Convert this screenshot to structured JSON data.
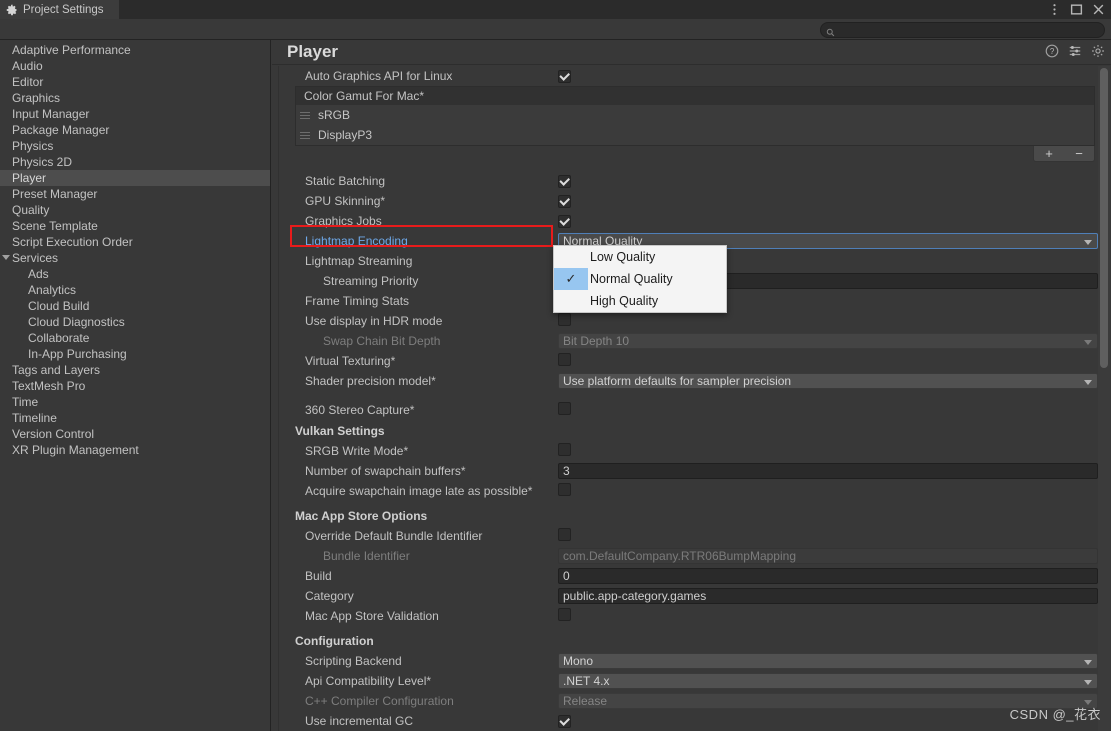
{
  "window": {
    "tab_title": "Project Settings",
    "tab_icon": "gear-icon",
    "controls": [
      "kebab-menu-icon",
      "maximize-icon",
      "close-icon"
    ]
  },
  "search": {
    "value": "",
    "placeholder": "",
    "icon": "search-icon"
  },
  "sidebar": {
    "items": [
      {
        "label": "Adaptive Performance",
        "indent": 0,
        "selected": false,
        "expandable": false
      },
      {
        "label": "Audio",
        "indent": 0,
        "selected": false,
        "expandable": false
      },
      {
        "label": "Editor",
        "indent": 0,
        "selected": false,
        "expandable": false
      },
      {
        "label": "Graphics",
        "indent": 0,
        "selected": false,
        "expandable": false
      },
      {
        "label": "Input Manager",
        "indent": 0,
        "selected": false,
        "expandable": false
      },
      {
        "label": "Package Manager",
        "indent": 0,
        "selected": false,
        "expandable": false
      },
      {
        "label": "Physics",
        "indent": 0,
        "selected": false,
        "expandable": false
      },
      {
        "label": "Physics 2D",
        "indent": 0,
        "selected": false,
        "expandable": false
      },
      {
        "label": "Player",
        "indent": 0,
        "selected": true,
        "expandable": false
      },
      {
        "label": "Preset Manager",
        "indent": 0,
        "selected": false,
        "expandable": false
      },
      {
        "label": "Quality",
        "indent": 0,
        "selected": false,
        "expandable": false
      },
      {
        "label": "Scene Template",
        "indent": 0,
        "selected": false,
        "expandable": false
      },
      {
        "label": "Script Execution Order",
        "indent": 0,
        "selected": false,
        "expandable": false
      },
      {
        "label": "Services",
        "indent": 0,
        "selected": false,
        "expandable": true
      },
      {
        "label": "Ads",
        "indent": 1,
        "selected": false,
        "expandable": false
      },
      {
        "label": "Analytics",
        "indent": 1,
        "selected": false,
        "expandable": false
      },
      {
        "label": "Cloud Build",
        "indent": 1,
        "selected": false,
        "expandable": false
      },
      {
        "label": "Cloud Diagnostics",
        "indent": 1,
        "selected": false,
        "expandable": false
      },
      {
        "label": "Collaborate",
        "indent": 1,
        "selected": false,
        "expandable": false
      },
      {
        "label": "In-App Purchasing",
        "indent": 1,
        "selected": false,
        "expandable": false
      },
      {
        "label": "Tags and Layers",
        "indent": 0,
        "selected": false,
        "expandable": false
      },
      {
        "label": "TextMesh Pro",
        "indent": 0,
        "selected": false,
        "expandable": false
      },
      {
        "label": "Time",
        "indent": 0,
        "selected": false,
        "expandable": false
      },
      {
        "label": "Timeline",
        "indent": 0,
        "selected": false,
        "expandable": false
      },
      {
        "label": "Version Control",
        "indent": 0,
        "selected": false,
        "expandable": false
      },
      {
        "label": "XR Plugin Management",
        "indent": 0,
        "selected": false,
        "expandable": false
      }
    ]
  },
  "page": {
    "title": "Player",
    "header_icons": [
      "help-icon",
      "preset-sliders-icon",
      "gear-icon"
    ]
  },
  "rows": {
    "auto_graphics_api": {
      "label": "Auto Graphics API  for Linux",
      "checked": true
    },
    "color_gamut": {
      "header": "Color Gamut For Mac*",
      "items": [
        "sRGB",
        "DisplayP3"
      ],
      "add_label": "+",
      "remove_label": "−"
    },
    "static_batching": {
      "label": "Static Batching",
      "checked": true
    },
    "gpu_skinning": {
      "label": "GPU Skinning*",
      "checked": true
    },
    "graphics_jobs": {
      "label": "Graphics Jobs",
      "checked": true
    },
    "lightmap_encoding": {
      "label": "Lightmap Encoding",
      "value": "Normal Quality"
    },
    "lightmap_streaming": {
      "label": "Lightmap Streaming",
      "checked": true
    },
    "streaming_priority": {
      "label": "Streaming Priority",
      "value": ""
    },
    "frame_timing_stats": {
      "label": "Frame Timing Stats",
      "checked": false
    },
    "hdr_mode": {
      "label": "Use display in HDR mode",
      "checked": false
    },
    "swap_chain_bit_depth": {
      "label": "Swap Chain Bit Depth",
      "value": "Bit Depth 10"
    },
    "virtual_texturing": {
      "label": "Virtual Texturing*",
      "checked": false
    },
    "shader_precision_model": {
      "label": "Shader precision model*",
      "value": "Use platform defaults for sampler precision"
    },
    "stereo_capture_360": {
      "label": "360 Stereo Capture*",
      "checked": false
    },
    "vulkan_settings": {
      "label": "Vulkan Settings"
    },
    "srgb_write_mode": {
      "label": "SRGB Write Mode*",
      "checked": false
    },
    "swapchain_buffers": {
      "label": "Number of swapchain buffers*",
      "value": "3"
    },
    "acquire_swapchain": {
      "label": "Acquire swapchain image late as possible*",
      "checked": false
    },
    "mac_app_store_options": {
      "label": "Mac App Store Options"
    },
    "override_bundle_id": {
      "label": "Override Default Bundle Identifier",
      "checked": false
    },
    "bundle_identifier": {
      "label": "Bundle Identifier",
      "value": "com.DefaultCompany.RTR06BumpMapping"
    },
    "build": {
      "label": "Build",
      "value": "0"
    },
    "category": {
      "label": "Category",
      "value": "public.app-category.games"
    },
    "mac_app_store_validation": {
      "label": "Mac App Store Validation",
      "checked": false
    },
    "configuration": {
      "label": "Configuration"
    },
    "scripting_backend": {
      "label": "Scripting Backend",
      "value": "Mono"
    },
    "api_compatibility_level": {
      "label": "Api Compatibility Level*",
      "value": ".NET 4.x"
    },
    "cpp_compiler_configuration": {
      "label": "C++ Compiler Configuration",
      "value": "Release"
    },
    "use_incremental_gc": {
      "label": "Use incremental GC",
      "checked": true
    }
  },
  "popup": {
    "options": [
      {
        "label": "Low Quality",
        "checked": false
      },
      {
        "label": "Normal Quality",
        "checked": true
      },
      {
        "label": "High Quality",
        "checked": false
      }
    ],
    "check_glyph": "✓"
  },
  "watermark": {
    "text": "CSDN @_花衣"
  },
  "colors": {
    "background": "#383838",
    "panel": "#3b3b3b",
    "selection": "#4d4d4d",
    "accent_blue": "#6ea8e8",
    "annotation_red": "#e81b1b",
    "popup_highlight": "#97c6f0"
  }
}
